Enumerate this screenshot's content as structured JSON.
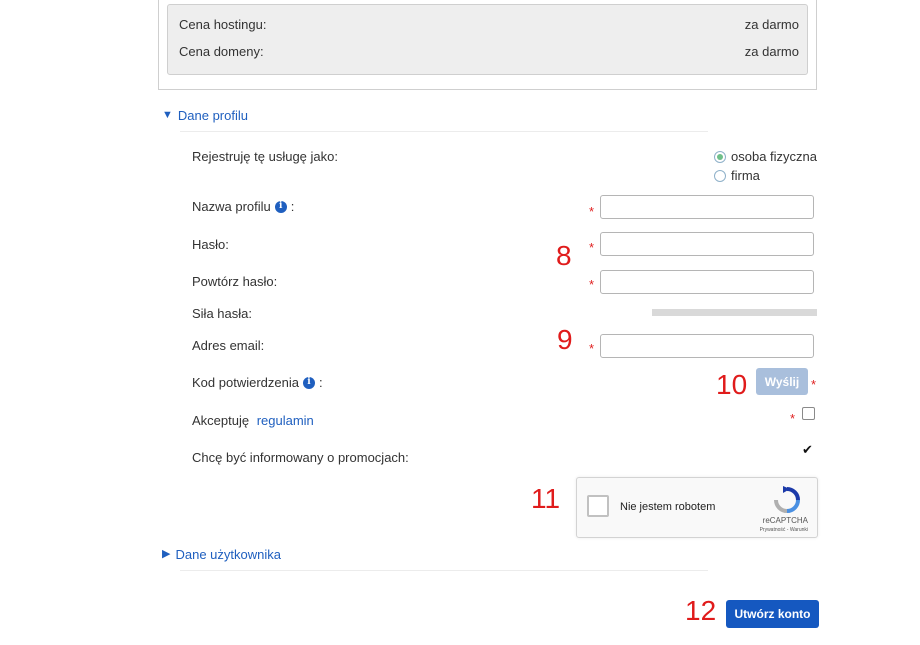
{
  "pricing": {
    "hosting_label": "Cena hostingu:",
    "hosting_value": "za darmo",
    "domain_label": "Cena domeny:",
    "domain_value": "za darmo"
  },
  "sections": {
    "profile": {
      "label": "Dane profilu",
      "expanded": true
    },
    "user": {
      "label": "Dane użytkownika",
      "expanded": false
    }
  },
  "form": {
    "register_as_label": "Rejestruję tę usługę jako:",
    "register_options": [
      {
        "label": "osoba fizyczna",
        "selected": true
      },
      {
        "label": "firma",
        "selected": false
      }
    ],
    "profile_name_label": "Nazwa profilu",
    "profile_name_value": "",
    "password_label": "Hasło:",
    "password_value": "",
    "repeat_password_label": "Powtórz hasło:",
    "repeat_password_value": "",
    "strength_label": "Siła hasła:",
    "strength_level": 0,
    "email_label": "Adres email:",
    "email_value": "",
    "code_label": "Kod potwierdzenia",
    "send_button": "Wyślij",
    "terms_prefix": "Akceptuję ",
    "terms_link": "regulamin",
    "terms_checked": false,
    "promo_label": "Chcę być informowany o promocjach:",
    "promo_checked": true,
    "colon": ":",
    "required_mark": "*"
  },
  "recaptcha": {
    "label": "Nie jestem robotem",
    "brand": "reCAPTCHA",
    "links": "Prywatność - Warunki"
  },
  "submit": {
    "label": "Utwórz konto"
  },
  "callouts": [
    "8",
    "9",
    "10",
    "11",
    "12"
  ],
  "colors": {
    "primary_button": "#1558c0",
    "disabled_button": "#a9bfdc",
    "link": "#1f5fbf",
    "required": "#e02020",
    "callout": "#e01b1b"
  }
}
